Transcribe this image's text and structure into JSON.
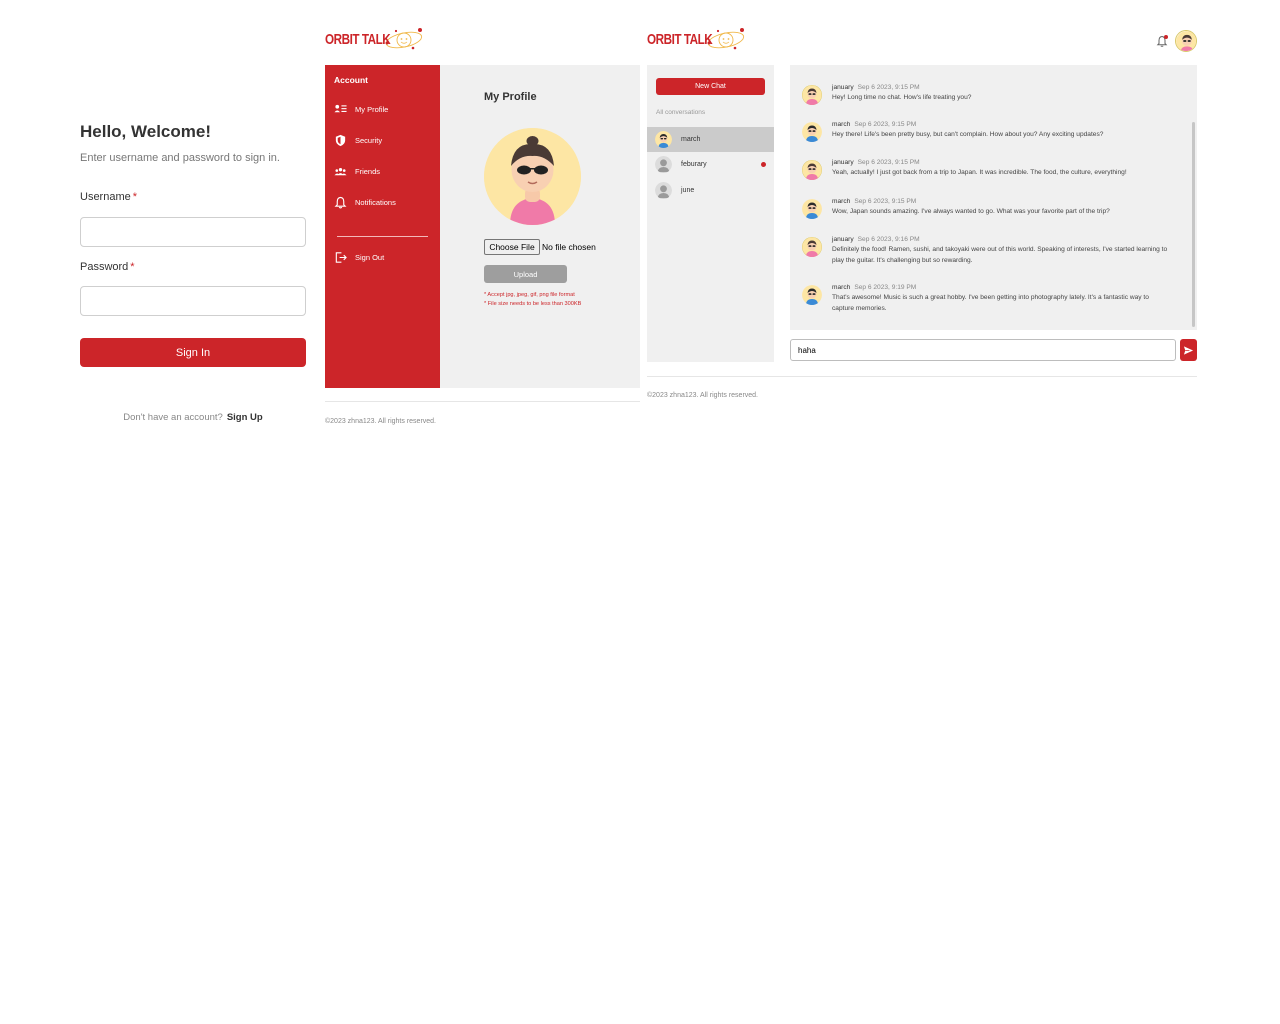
{
  "login": {
    "title": "Hello, Welcome!",
    "subtitle": "Enter username and password to sign in.",
    "username_label": "Username",
    "password_label": "Password",
    "required_mark": "*",
    "username_value": "",
    "password_value": "",
    "signin_label": "Sign In",
    "no_account_text": "Don't have an account?",
    "signup_label": "Sign Up"
  },
  "brand": {
    "name": "ORBIT TALK",
    "accent_color": "#cc2529"
  },
  "profile": {
    "sidebar_title": "Account",
    "sidebar_items": [
      {
        "label": "My Profile",
        "icon": "profile-list-icon"
      },
      {
        "label": "Security",
        "icon": "shield-icon"
      },
      {
        "label": "Friends",
        "icon": "friends-icon"
      },
      {
        "label": "Notifications",
        "icon": "bell-icon"
      }
    ],
    "signout_label": "Sign Out",
    "title": "My Profile",
    "choose_file_label": "Choose File",
    "no_file_label": "No file chosen",
    "upload_label": "Upload",
    "note_format": "* Accept jpg, jpeg, gif, png file format",
    "note_size": "* File size needs to be less than 300KB",
    "footer": "©2023 zhna123. All rights reserved."
  },
  "chat": {
    "new_chat_label": "New Chat",
    "all_conversations_label": "All conversations",
    "conversations": [
      {
        "name": "march",
        "active": true,
        "unread": false,
        "avatar": "avatar-sunglasses"
      },
      {
        "name": "feburary",
        "active": false,
        "unread": true,
        "avatar": "default-avatar"
      },
      {
        "name": "june",
        "active": false,
        "unread": false,
        "avatar": "default-avatar"
      }
    ],
    "messages": [
      {
        "sender": "january",
        "time": "Sep 6 2023, 9:15 PM",
        "text": "Hey! Long time no chat. How's life treating you?"
      },
      {
        "sender": "march",
        "time": "Sep 6 2023, 9:15 PM",
        "text": "Hey there! Life's been pretty busy, but can't complain. How about you? Any exciting updates?"
      },
      {
        "sender": "january",
        "time": "Sep 6 2023, 9:15 PM",
        "text": "Yeah, actually! I just got back from a trip to Japan. It was incredible. The food, the culture, everything!"
      },
      {
        "sender": "march",
        "time": "Sep 6 2023, 9:15 PM",
        "text": "Wow, Japan sounds amazing. I've always wanted to go. What was your favorite part of the trip?"
      },
      {
        "sender": "january",
        "time": "Sep 6 2023, 9:16 PM",
        "text": "Definitely the food! Ramen, sushi, and takoyaki were out of this world. Speaking of interests, I've started learning to play the guitar. It's challenging but so rewarding."
      },
      {
        "sender": "march",
        "time": "Sep 6 2023, 9:19 PM",
        "text": "That's awesome! Music is such a great hobby. I've been getting into photography lately. It's a fantastic way to capture memories."
      }
    ],
    "input_value": "haha",
    "footer": "©2023 zhna123. All rights reserved."
  }
}
